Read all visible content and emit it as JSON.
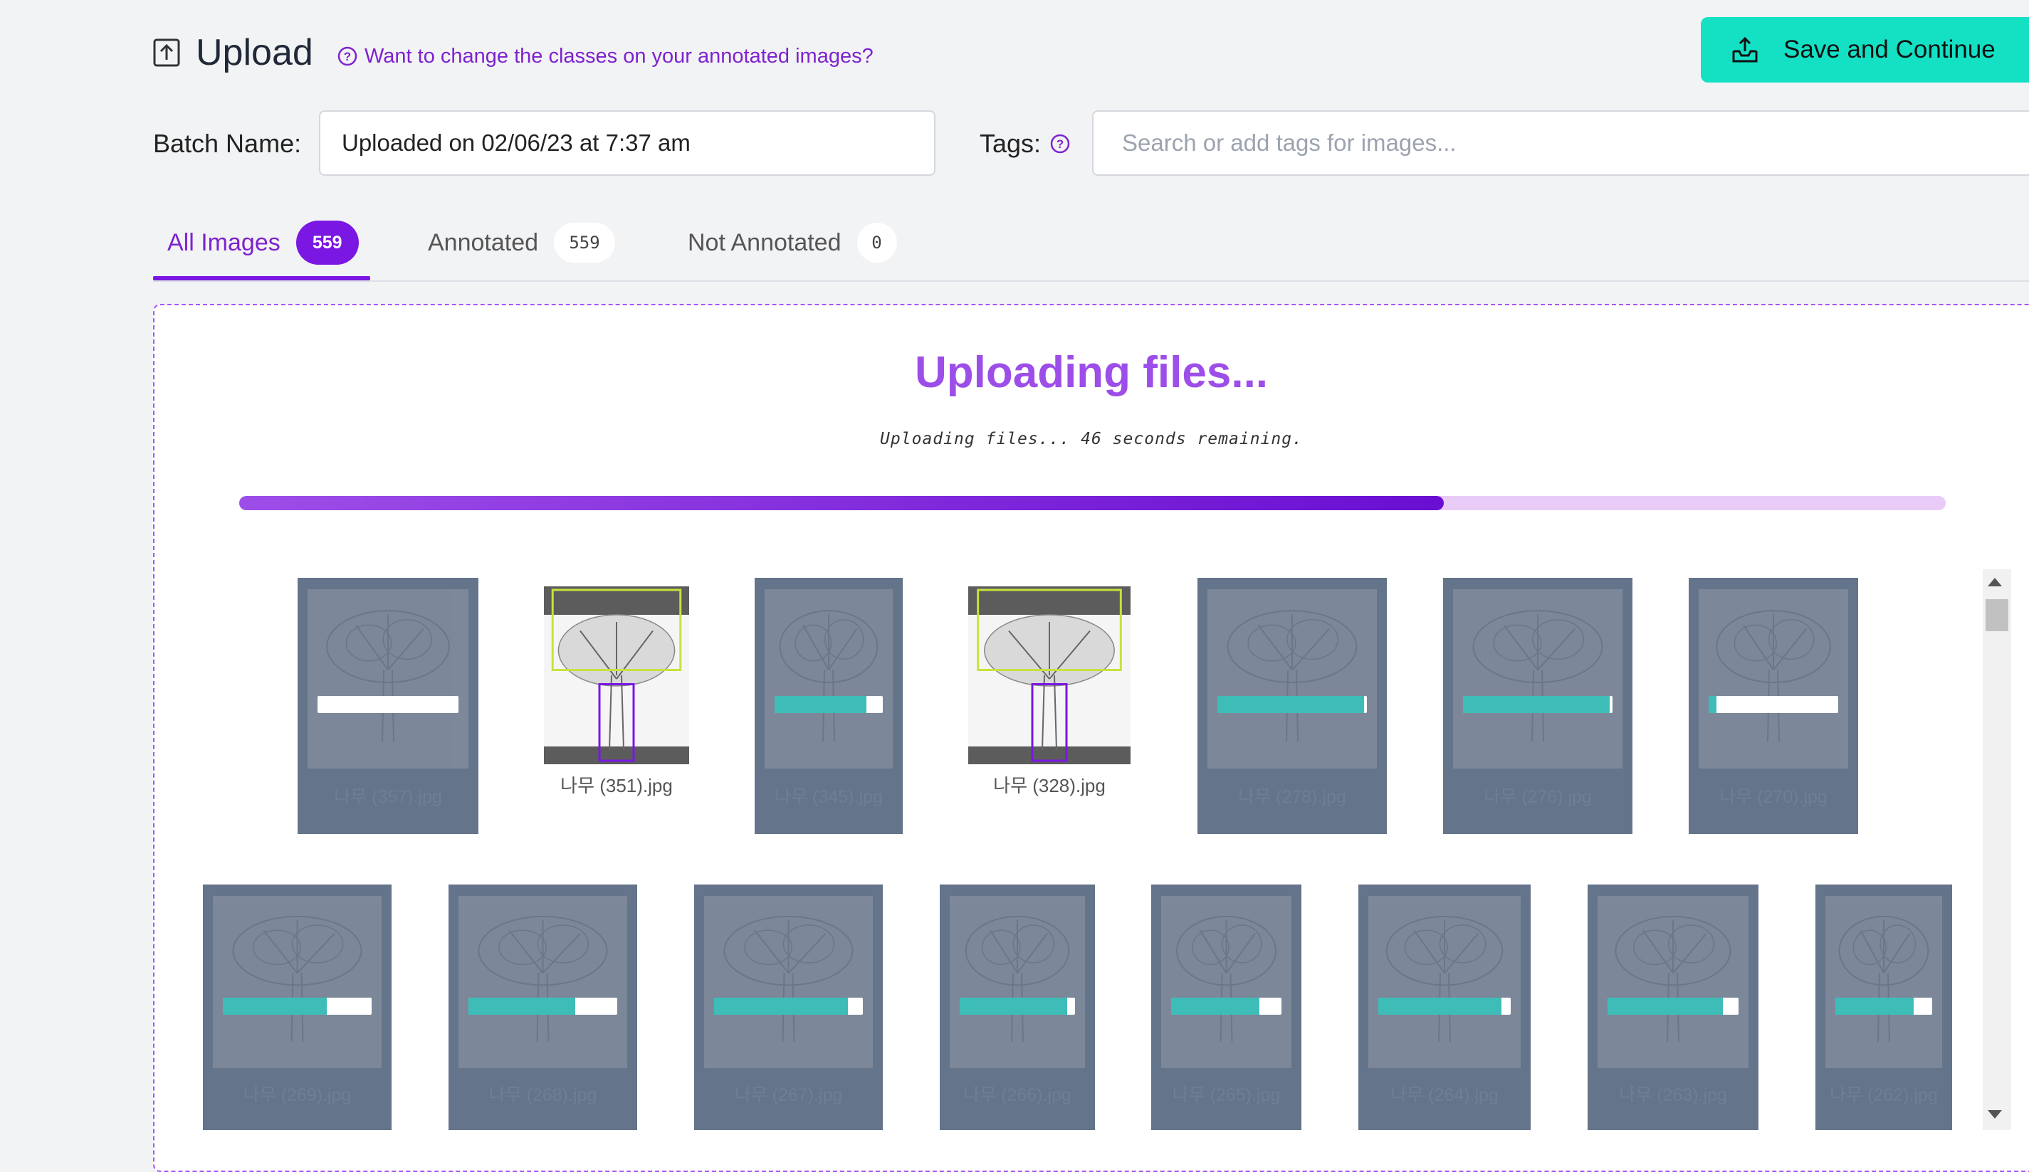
{
  "header": {
    "title": "Upload",
    "icon": "upload-box-icon",
    "help_link": "Want to change the classes on your annotated images?",
    "save_button": "Save and Continue",
    "accent": "#7a17e3",
    "button_color": "#14e0c4"
  },
  "batch": {
    "label": "Batch Name:",
    "value": "Uploaded on 02/06/23 at 7:37 am"
  },
  "tags": {
    "label": "Tags:",
    "placeholder": "Search or add tags for images..."
  },
  "tabs": [
    {
      "label": "All Images",
      "count": "559"
    },
    {
      "label": "Annotated",
      "count": "559"
    },
    {
      "label": "Not Annotated",
      "count": "0"
    }
  ],
  "upload": {
    "title": "Uploading files...",
    "status": "Uploading files... 46 seconds remaining.",
    "progress": 0.706
  },
  "images": [
    {
      "name": "나무 (357).jpg",
      "state": "uploading",
      "progress": 0.0
    },
    {
      "name": "나무 (351).jpg",
      "state": "done"
    },
    {
      "name": "나무 (345).jpg",
      "state": "uploading",
      "progress": 0.85
    },
    {
      "name": "나무 (328).jpg",
      "state": "done"
    },
    {
      "name": "나무 (278).jpg",
      "state": "uploading",
      "progress": 0.98
    },
    {
      "name": "나무 (276).jpg",
      "state": "uploading",
      "progress": 0.98
    },
    {
      "name": "나무 (270).jpg",
      "state": "uploading",
      "progress": 0.06
    },
    {
      "name": "나무 (269).jpg",
      "state": "uploading",
      "progress": 0.7
    },
    {
      "name": "나무 (268).jpg",
      "state": "uploading",
      "progress": 0.72
    },
    {
      "name": "나무 (267).jpg",
      "state": "uploading",
      "progress": 0.9
    },
    {
      "name": "나무 (266).jpg",
      "state": "uploading",
      "progress": 0.93
    },
    {
      "name": "나무 (265).jpg",
      "state": "uploading",
      "progress": 0.8
    },
    {
      "name": "나무 (264).jpg",
      "state": "uploading",
      "progress": 0.93
    },
    {
      "name": "나무 (263).jpg",
      "state": "uploading",
      "progress": 0.88
    },
    {
      "name": "나무 (262).jpg",
      "state": "uploading",
      "progress": 0.81
    }
  ]
}
